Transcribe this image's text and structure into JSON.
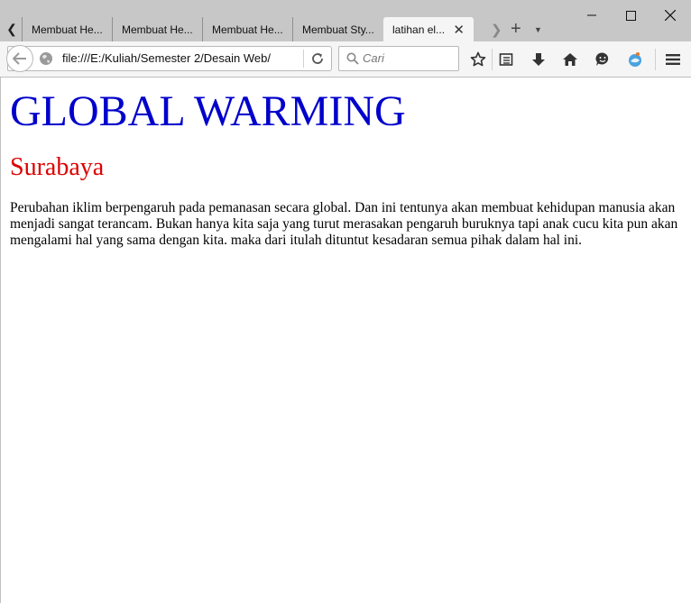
{
  "browser": {
    "tabs": [
      {
        "label": "Membuat He..."
      },
      {
        "label": "Membuat He..."
      },
      {
        "label": "Membuat He..."
      },
      {
        "label": "Membuat Sty..."
      },
      {
        "label": "latihan el...",
        "active": true
      }
    ],
    "url": "file:///E:/Kuliah/Semester 2/Desain Web/",
    "search_placeholder": "Cari"
  },
  "page": {
    "heading": "GLOBAL WARMING",
    "subheading": "Surabaya",
    "paragraph": "Perubahan iklim berpengaruh pada pemanasan secara global. Dan ini tentunya akan membuat kehidupan manusia akan menjadi sangat terancam. Bukan hanya kita saja yang turut merasakan pengaruh buruknya tapi anak cucu kita pun akan mengalami hal yang sama dengan kita. maka dari itulah dituntut kesadaran semua pihak dalam hal ini."
  },
  "colors": {
    "heading": "#0000cc",
    "subheading": "#dd0000"
  }
}
